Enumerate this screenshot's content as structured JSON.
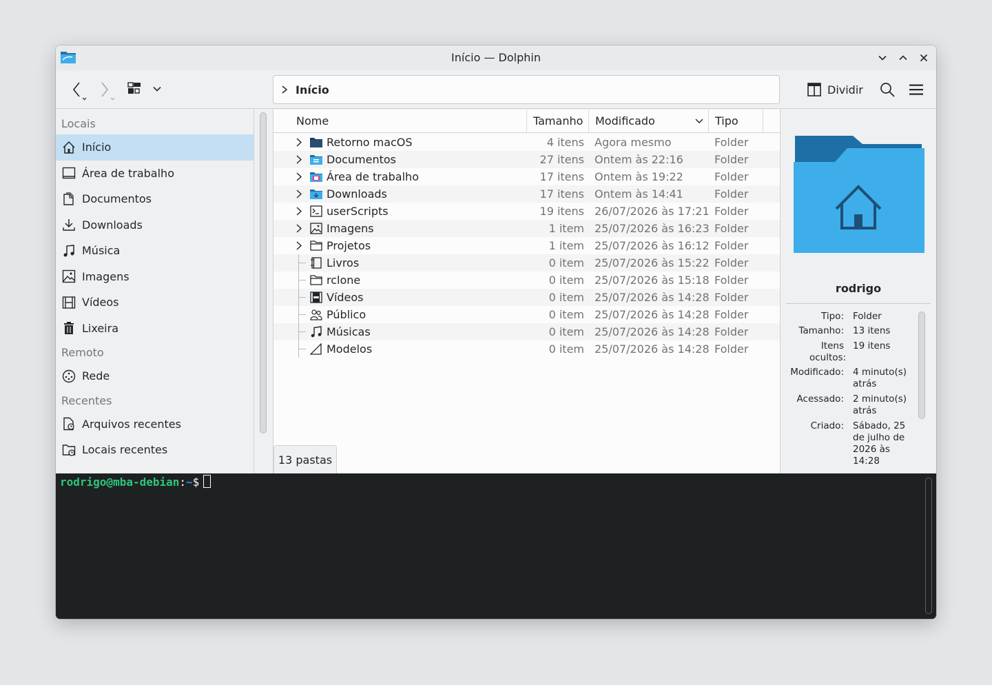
{
  "window": {
    "title": "Início — Dolphin"
  },
  "toolbar": {
    "split_label": "Dividir"
  },
  "breadcrumb": {
    "current": "Início"
  },
  "sidebar": {
    "sections": [
      {
        "title": "Locais",
        "items": [
          {
            "label": "Início",
            "icon": "home-icon",
            "active": true
          },
          {
            "label": "Área de trabalho",
            "icon": "desktop-icon"
          },
          {
            "label": "Documentos",
            "icon": "documents-icon"
          },
          {
            "label": "Downloads",
            "icon": "downloads-icon"
          },
          {
            "label": "Música",
            "icon": "music-icon"
          },
          {
            "label": "Imagens",
            "icon": "images-icon"
          },
          {
            "label": "Vídeos",
            "icon": "videos-icon"
          },
          {
            "label": "Lixeira",
            "icon": "trash-icon"
          }
        ]
      },
      {
        "title": "Remoto",
        "items": [
          {
            "label": "Rede",
            "icon": "network-icon"
          }
        ]
      },
      {
        "title": "Recentes",
        "items": [
          {
            "label": "Arquivos recentes",
            "icon": "recent-files-icon"
          },
          {
            "label": "Locais recentes",
            "icon": "recent-locations-icon"
          }
        ]
      }
    ]
  },
  "table": {
    "columns": {
      "name": "Nome",
      "size": "Tamanho",
      "modified": "Modificado",
      "type": "Tipo"
    },
    "rows": [
      {
        "name": "Retorno macOS",
        "size": "4 itens",
        "modified": "Agora mesmo",
        "type": "Folder",
        "expandable": true,
        "icon": "folder-dark-icon"
      },
      {
        "name": "Documentos",
        "size": "27 itens",
        "modified": "Ontem às 22:16",
        "type": "Folder",
        "expandable": true,
        "icon": "folder-documents-icon"
      },
      {
        "name": "Área de trabalho",
        "size": "17 itens",
        "modified": "Ontem às 19:22",
        "type": "Folder",
        "expandable": true,
        "icon": "folder-desktop-icon"
      },
      {
        "name": "Downloads",
        "size": "17 itens",
        "modified": "Ontem às 14:41",
        "type": "Folder",
        "expandable": true,
        "icon": "folder-downloads-icon"
      },
      {
        "name": "userScripts",
        "size": "19 itens",
        "modified": "26/07/2026 às 17:21",
        "type": "Folder",
        "expandable": true,
        "icon": "terminal-folder-icon"
      },
      {
        "name": "Imagens",
        "size": "1 item",
        "modified": "25/07/2026 às 16:23",
        "type": "Folder",
        "expandable": true,
        "icon": "image-folder-icon"
      },
      {
        "name": "Projetos",
        "size": "1 item",
        "modified": "25/07/2026 às 16:12",
        "type": "Folder",
        "expandable": true,
        "icon": "folder-outline-icon"
      },
      {
        "name": "Livros",
        "size": "0 item",
        "modified": "25/07/2026 às 15:22",
        "type": "Folder",
        "expandable": false,
        "icon": "book-icon"
      },
      {
        "name": "rclone",
        "size": "0 item",
        "modified": "25/07/2026 às 15:18",
        "type": "Folder",
        "expandable": false,
        "icon": "folder-outline-icon"
      },
      {
        "name": "Vídeos",
        "size": "0 item",
        "modified": "25/07/2026 às 14:28",
        "type": "Folder",
        "expandable": false,
        "icon": "film-icon"
      },
      {
        "name": "Público",
        "size": "0 item",
        "modified": "25/07/2026 às 14:28",
        "type": "Folder",
        "expandable": false,
        "icon": "users-icon"
      },
      {
        "name": "Músicas",
        "size": "0 item",
        "modified": "25/07/2026 às 14:28",
        "type": "Folder",
        "expandable": false,
        "icon": "music-icon"
      },
      {
        "name": "Modelos",
        "size": "0 item",
        "modified": "25/07/2026 às 14:28",
        "type": "Folder",
        "expandable": false,
        "icon": "template-icon"
      }
    ]
  },
  "status": {
    "text": "13 pastas"
  },
  "info_panel": {
    "name": "rodrigo",
    "props": [
      {
        "key": "Tipo:",
        "value": "Folder"
      },
      {
        "key": "Tamanho:",
        "value": "13 itens"
      },
      {
        "key": "Itens ocultos:",
        "value": "19 itens"
      },
      {
        "key": "Modificado:",
        "value": "4 minuto(s) atrás"
      },
      {
        "key": "Acessado:",
        "value": "2 minuto(s) atrás"
      },
      {
        "key": "Criado:",
        "value": "Sábado, 25 de julho de 2026 às 14:28"
      }
    ]
  },
  "terminal": {
    "user_host": "rodrigo@mba-debian",
    "colon": ":",
    "path": "~",
    "prompt": "$"
  },
  "colors": {
    "accent": "#3daee9",
    "selection": "#c4dff3",
    "terminal_bg": "#1e2122",
    "terminal_user": "#2fc57c"
  }
}
